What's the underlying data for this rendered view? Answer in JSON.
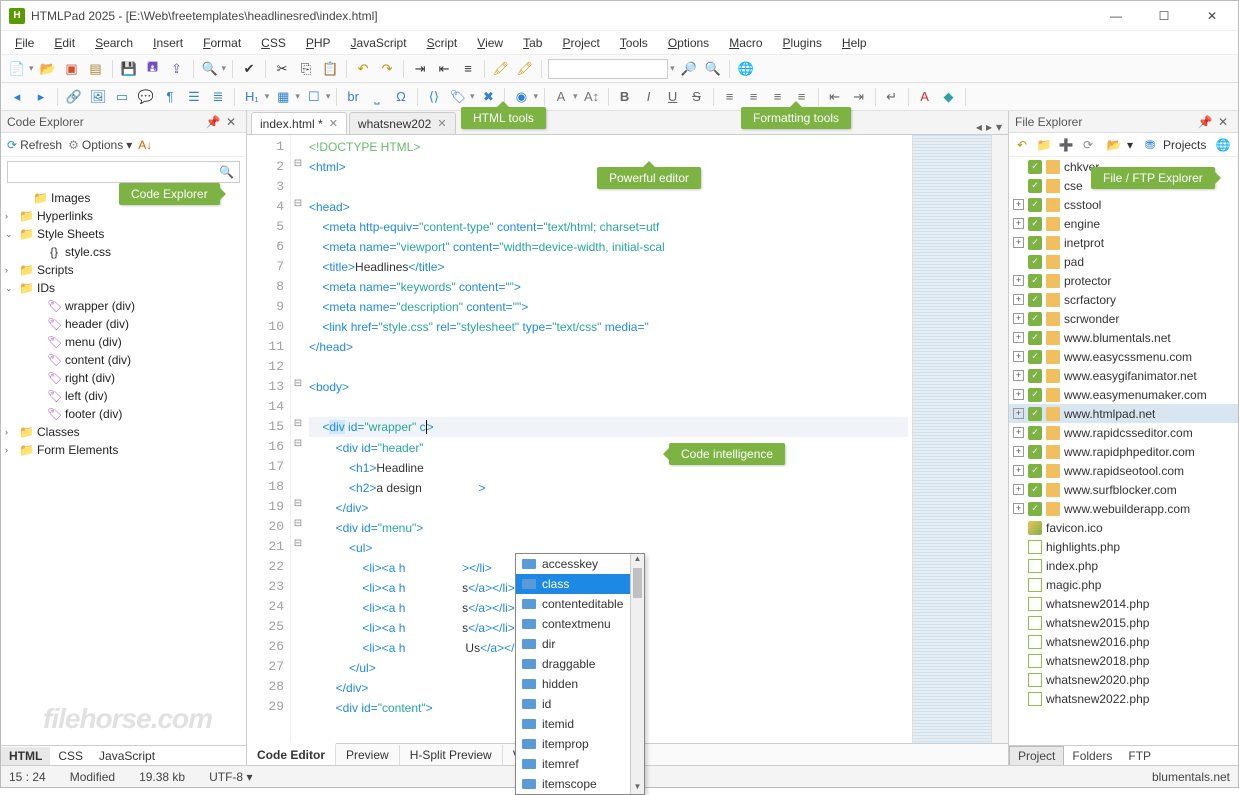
{
  "titlebar": {
    "app": "HTMLPad 2025",
    "path": "[E:\\Web\\freetemplates\\headlinesred\\index.html]"
  },
  "menus": [
    "File",
    "Edit",
    "Search",
    "Insert",
    "Format",
    "CSS",
    "PHP",
    "JavaScript",
    "Script",
    "View",
    "Tab",
    "Project",
    "Tools",
    "Options",
    "Macro",
    "Plugins",
    "Help"
  ],
  "left_panel": {
    "title": "Code Explorer",
    "refresh": "Refresh",
    "options": "Options",
    "search_placeholder": "",
    "tree": [
      {
        "indent": 1,
        "chev": "",
        "icon": "folder",
        "label": "Images"
      },
      {
        "indent": 0,
        "chev": "›",
        "icon": "folder",
        "label": "Hyperlinks"
      },
      {
        "indent": 0,
        "chev": "⌄",
        "icon": "folder",
        "label": "Style Sheets"
      },
      {
        "indent": 2,
        "chev": "",
        "icon": "css",
        "label": "style.css"
      },
      {
        "indent": 0,
        "chev": "›",
        "icon": "folder",
        "label": "Scripts"
      },
      {
        "indent": 0,
        "chev": "⌄",
        "icon": "folder",
        "label": "IDs"
      },
      {
        "indent": 2,
        "chev": "",
        "icon": "tag",
        "label": "wrapper (div)"
      },
      {
        "indent": 2,
        "chev": "",
        "icon": "tag",
        "label": "header (div)"
      },
      {
        "indent": 2,
        "chev": "",
        "icon": "tag",
        "label": "menu (div)"
      },
      {
        "indent": 2,
        "chev": "",
        "icon": "tag",
        "label": "content (div)"
      },
      {
        "indent": 2,
        "chev": "",
        "icon": "tag",
        "label": "right (div)"
      },
      {
        "indent": 2,
        "chev": "",
        "icon": "tag",
        "label": "left (div)"
      },
      {
        "indent": 2,
        "chev": "",
        "icon": "tag",
        "label": "footer (div)"
      },
      {
        "indent": 0,
        "chev": "›",
        "icon": "folder",
        "label": "Classes"
      },
      {
        "indent": 0,
        "chev": "›",
        "icon": "folder",
        "label": "Form Elements"
      }
    ]
  },
  "left_tabs": [
    "HTML",
    "CSS",
    "JavaScript"
  ],
  "doc_tabs": [
    {
      "label": "index.html *",
      "active": true
    },
    {
      "label": "whatsnew202",
      "active": false
    }
  ],
  "callouts": {
    "code_explorer": "Code Explorer",
    "html_tools": "HTML tools",
    "formatting_tools": "Formatting tools",
    "powerful_editor": "Powerful editor",
    "code_intelligence": "Code intelligence",
    "file_explorer": "File / FTP Explorer"
  },
  "code_lines": [
    {
      "n": 1,
      "html": "<span class='tok-doctype'>&lt;!DOCTYPE HTML&gt;</span>"
    },
    {
      "n": 2,
      "html": "<span class='tok-tag'>&lt;html&gt;</span>"
    },
    {
      "n": 3,
      "html": ""
    },
    {
      "n": 4,
      "html": "<span class='tok-tag'>&lt;head&gt;</span>"
    },
    {
      "n": 5,
      "html": "    <span class='tok-tag'>&lt;meta</span> <span class='tok-attr'>http-equiv=</span><span class='tok-str'>\"content-type\"</span> <span class='tok-attr'>content=</span><span class='tok-str'>\"text/html; charset=utf</span>"
    },
    {
      "n": 6,
      "html": "    <span class='tok-tag'>&lt;meta</span> <span class='tok-attr'>name=</span><span class='tok-str'>\"viewport\"</span> <span class='tok-attr'>content=</span><span class='tok-str'>\"width=device-width, initial-scal</span>"
    },
    {
      "n": 7,
      "html": "    <span class='tok-tag'>&lt;title&gt;</span><span class='tok-text'>Headlines</span><span class='tok-tag'>&lt;/title&gt;</span>"
    },
    {
      "n": 8,
      "html": "    <span class='tok-tag'>&lt;meta</span> <span class='tok-attr'>name=</span><span class='tok-str'>\"keywords\"</span> <span class='tok-attr'>content=</span><span class='tok-str'>\"\"</span><span class='tok-tag'>&gt;</span>"
    },
    {
      "n": 9,
      "html": "    <span class='tok-tag'>&lt;meta</span> <span class='tok-attr'>name=</span><span class='tok-str'>\"description\"</span> <span class='tok-attr'>content=</span><span class='tok-str'>\"\"</span><span class='tok-tag'>&gt;</span>"
    },
    {
      "n": 10,
      "html": "    <span class='tok-tag'>&lt;link</span> <span class='tok-attr'>href=</span><span class='tok-str'>\"style.css\"</span> <span class='tok-attr'>rel=</span><span class='tok-str'>\"stylesheet\"</span> <span class='tok-attr'>type=</span><span class='tok-str'>\"text/css\"</span> <span class='tok-attr'>media=</span><span class='tok-str'>\"</span>"
    },
    {
      "n": 11,
      "html": "<span class='tok-tag'>&lt;/head&gt;</span>"
    },
    {
      "n": 12,
      "html": ""
    },
    {
      "n": 13,
      "html": "<span class='tok-tag'>&lt;body&gt;</span>"
    },
    {
      "n": 14,
      "html": ""
    },
    {
      "n": 15,
      "html": "    <span class='tok-tag'>&lt;<span class='hl'>div</span></span> <span class='tok-attr'>id=</span><span class='tok-str'>\"wrapper\"</span> <span class='tok-attr'>c</span><span class='caret'></span><span class='tok-tag'>&gt;</span>",
      "cur": true
    },
    {
      "n": 16,
      "html": "        <span class='tok-tag'>&lt;div</span> <span class='tok-attr'>id=</span><span class='tok-str'>\"header\"</span>"
    },
    {
      "n": 17,
      "html": "            <span class='tok-tag'>&lt;h1&gt;</span><span class='tok-text'>Headline</span>"
    },
    {
      "n": 18,
      "html": "            <span class='tok-tag'>&lt;h2&gt;</span><span class='tok-text'>a design</span>                 <span class='tok-tag'>&gt;</span>"
    },
    {
      "n": 19,
      "html": "        <span class='tok-tag'>&lt;/div&gt;</span>"
    },
    {
      "n": 20,
      "html": "        <span class='tok-tag'>&lt;div</span> <span class='tok-attr'>id=</span><span class='tok-str'>\"menu\"</span><span class='tok-tag'>&gt;</span>"
    },
    {
      "n": 21,
      "html": "            <span class='tok-tag'>&lt;ul&gt;</span>"
    },
    {
      "n": 22,
      "html": "                <span class='tok-tag'>&lt;li&gt;&lt;a</span> <span class='tok-attr'>h</span>                 <span class='tok-tag'>&gt;&lt;/li&gt;</span>"
    },
    {
      "n": 23,
      "html": "                <span class='tok-tag'>&lt;li&gt;&lt;a</span> <span class='tok-attr'>h</span>                 <span class='tok-text'>s</span><span class='tok-tag'>&lt;/a&gt;&lt;/li&gt;</span>"
    },
    {
      "n": 24,
      "html": "                <span class='tok-tag'>&lt;li&gt;&lt;a</span> <span class='tok-attr'>h</span>                 <span class='tok-text'>s</span><span class='tok-tag'>&lt;/a&gt;&lt;/li&gt;</span>"
    },
    {
      "n": 25,
      "html": "                <span class='tok-tag'>&lt;li&gt;&lt;a</span> <span class='tok-attr'>h</span>                 <span class='tok-text'>s</span><span class='tok-tag'>&lt;/a&gt;&lt;/li&gt;</span>"
    },
    {
      "n": 26,
      "html": "                <span class='tok-tag'>&lt;li&gt;&lt;a</span> <span class='tok-attr'>h</span>                  <span class='tok-text'>Us</span><span class='tok-tag'>&lt;/a&gt;&lt;/li&gt;</span>"
    },
    {
      "n": 27,
      "html": "            <span class='tok-tag'>&lt;/ul&gt;</span>"
    },
    {
      "n": 28,
      "html": "        <span class='tok-tag'>&lt;/div&gt;</span>"
    },
    {
      "n": 29,
      "html": "        <span class='tok-tag'>&lt;div</span> <span class='tok-attr'>id=</span><span class='tok-str'>\"content\"</span><span class='tok-tag'>&gt;</span>"
    }
  ],
  "autocomplete": [
    "accesskey",
    "class",
    "contenteditable",
    "contextmenu",
    "dir",
    "draggable",
    "hidden",
    "id",
    "itemid",
    "itemprop",
    "itemref",
    "itemscope"
  ],
  "autocomplete_sel": 1,
  "bottom_tabs": [
    "Code Editor",
    "Preview",
    "H-Split Preview",
    "V-Split Preview"
  ],
  "right_panel": {
    "title": "File Explorer",
    "projects": "Projects",
    "items": [
      {
        "exp": "",
        "type": "g",
        "label": "chkver"
      },
      {
        "exp": "",
        "type": "g",
        "label": "cse"
      },
      {
        "exp": "+",
        "type": "g",
        "label": "csstool"
      },
      {
        "exp": "+",
        "type": "g",
        "label": "engine"
      },
      {
        "exp": "+",
        "type": "g",
        "label": "inetprot"
      },
      {
        "exp": "",
        "type": "g",
        "label": "pad"
      },
      {
        "exp": "+",
        "type": "g",
        "label": "protector"
      },
      {
        "exp": "+",
        "type": "g",
        "label": "scrfactory"
      },
      {
        "exp": "+",
        "type": "g",
        "label": "scrwonder"
      },
      {
        "exp": "+",
        "type": "g",
        "label": "www.blumentals.net"
      },
      {
        "exp": "+",
        "type": "g",
        "label": "www.easycssmenu.com"
      },
      {
        "exp": "+",
        "type": "g",
        "label": "www.easygifanimator.net"
      },
      {
        "exp": "+",
        "type": "g",
        "label": "www.easymenumaker.com"
      },
      {
        "exp": "+",
        "type": "g",
        "label": "www.htmlpad.net",
        "sel": true
      },
      {
        "exp": "+",
        "type": "g",
        "label": "www.rapidcsseditor.com"
      },
      {
        "exp": "+",
        "type": "g",
        "label": "www.rapidphpeditor.com"
      },
      {
        "exp": "+",
        "type": "g",
        "label": "www.rapidseotool.com"
      },
      {
        "exp": "+",
        "type": "g",
        "label": "www.surfblocker.com"
      },
      {
        "exp": "+",
        "type": "g",
        "label": "www.webuilderapp.com"
      },
      {
        "exp": "",
        "type": "fav",
        "label": "favicon.ico"
      },
      {
        "exp": "",
        "type": "php",
        "label": "highlights.php"
      },
      {
        "exp": "",
        "type": "php",
        "label": "index.php"
      },
      {
        "exp": "",
        "type": "php",
        "label": "magic.php"
      },
      {
        "exp": "",
        "type": "php",
        "label": "whatsnew2014.php"
      },
      {
        "exp": "",
        "type": "php",
        "label": "whatsnew2015.php"
      },
      {
        "exp": "",
        "type": "php",
        "label": "whatsnew2016.php"
      },
      {
        "exp": "",
        "type": "php",
        "label": "whatsnew2018.php"
      },
      {
        "exp": "",
        "type": "php",
        "label": "whatsnew2020.php"
      },
      {
        "exp": "",
        "type": "php",
        "label": "whatsnew2022.php"
      }
    ],
    "tabs": [
      "Project",
      "Folders",
      "FTP"
    ]
  },
  "status": {
    "pos": "15 : 24",
    "mod": "Modified",
    "size": "19.38 kb",
    "enc": "UTF-8",
    "site": "blumentals.net"
  },
  "watermark": "filehorse.com"
}
